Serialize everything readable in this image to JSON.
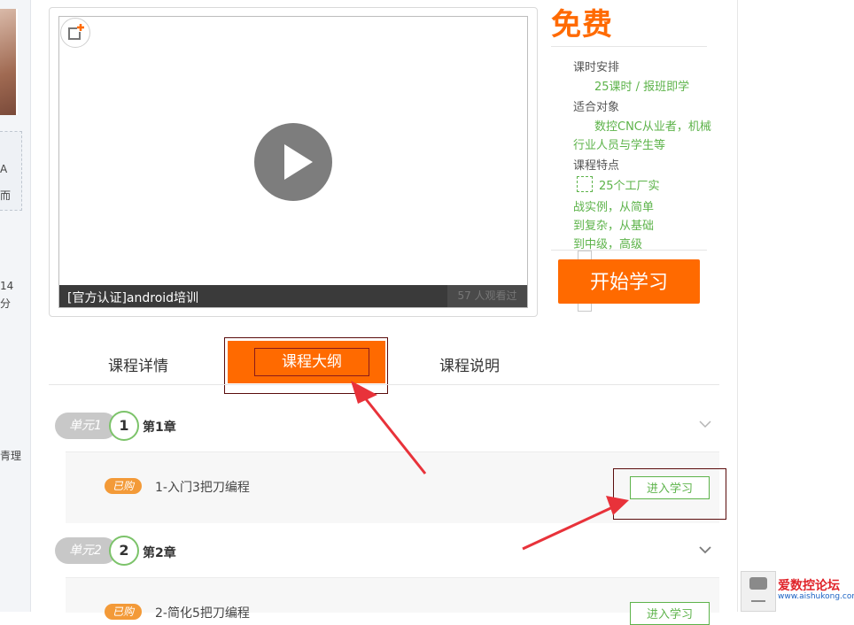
{
  "left": {
    "lines": [
      "A",
      "而",
      "14",
      "分",
      "青理"
    ]
  },
  "video": {
    "caption": "[官方认证]android培训",
    "viewers": "57 人观看过"
  },
  "info": {
    "price": "免费",
    "schedule_label": "课时安排",
    "schedule_value": "25课时 / 报班即学",
    "audience_label": "适合对象",
    "audience_value_1": "数控CNC从业者，机械",
    "audience_value_2": "行业人员与学生等",
    "features_label": "课程特点",
    "features_line_1": "25个工厂实",
    "features_line_2": "战实例，从简单",
    "features_line_3": "到复杂，从基础",
    "features_line_4": "到中级，高级",
    "start_button": "开始学习"
  },
  "tabs": [
    {
      "label": "课程详情"
    },
    {
      "label": "课程大纲"
    },
    {
      "label": "课程说明"
    }
  ],
  "outline": {
    "units": [
      {
        "unit_label": "单元1",
        "number": "1",
        "chapter": "第1章",
        "lesson_badge": "已购",
        "lesson_title": "1-入门3把刀编程",
        "enter_label": "进入学习"
      },
      {
        "unit_label": "单元2",
        "number": "2",
        "chapter": "第2章",
        "lesson_badge": "已购",
        "lesson_title": "2-简化5把刀编程",
        "enter_label": "进入学习"
      }
    ]
  },
  "widget": {
    "brand": "爱数控论坛",
    "url": "www.aishukong.com"
  },
  "colors": {
    "accent_orange": "#ff6a00",
    "green": "#5db34a",
    "annotation_red": "#e8323a"
  }
}
